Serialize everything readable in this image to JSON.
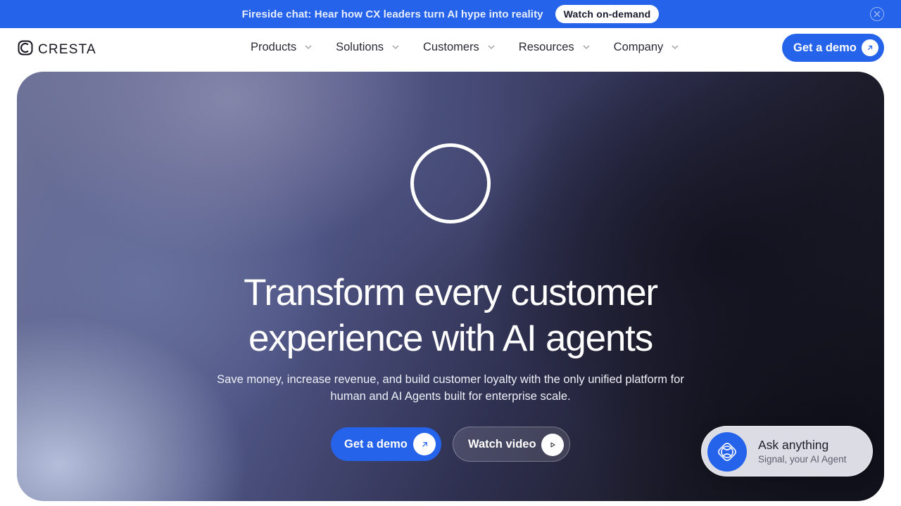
{
  "announcement": {
    "text": "Fireside chat: Hear how CX leaders turn AI hype into reality",
    "button_label": "Watch on-demand",
    "close_icon": "close-icon"
  },
  "header": {
    "logo_text": "CRESTA",
    "logo_icon": "cresta-logo-icon",
    "nav": [
      {
        "label": "Products"
      },
      {
        "label": "Solutions"
      },
      {
        "label": "Customers"
      },
      {
        "label": "Resources"
      },
      {
        "label": "Company"
      }
    ],
    "cta_label": "Get a demo",
    "cta_icon": "arrow-up-right-icon"
  },
  "hero": {
    "title_line1": "Transform every customer",
    "title_line2": "experience with AI agents",
    "subtitle_line1": "Save money, increase revenue, and build customer loyalty with the only unified platform for",
    "subtitle_line2": "human and AI Agents built for enterprise scale.",
    "primary_button_label": "Get a demo",
    "secondary_button_label": "Watch video",
    "secondary_icon": "play-icon"
  },
  "ask_widget": {
    "title": "Ask anything",
    "subtitle": "Signal, your AI Agent"
  },
  "colors": {
    "brand_blue": "#2563eb",
    "hero_dark": "#15151f",
    "hero_light": "#b9c3de"
  }
}
